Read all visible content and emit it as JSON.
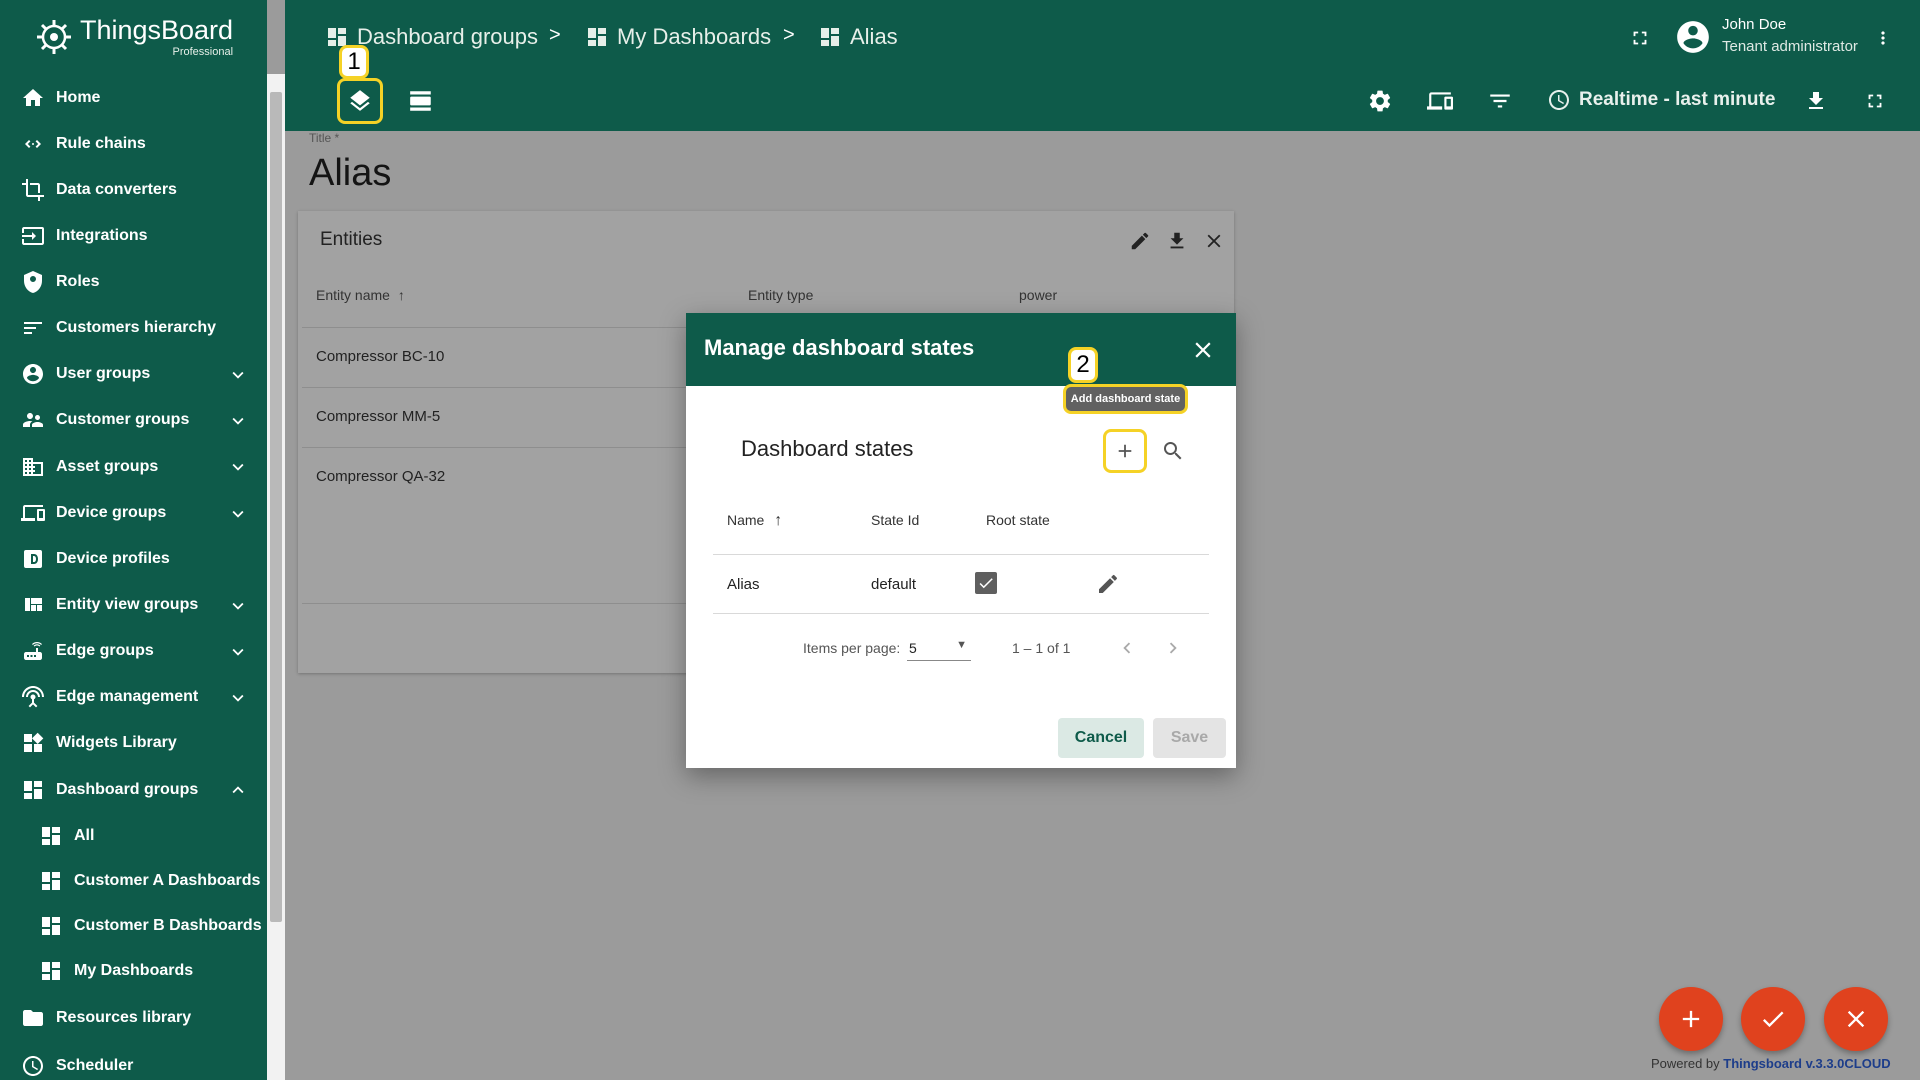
{
  "app": {
    "brand": "ThingsBoard",
    "edition": "Professional",
    "accent": "#0e5b4a",
    "fab_color": "#e0421e",
    "highlight_color": "#f5d226"
  },
  "sidebar": {
    "items": [
      {
        "label": "Home",
        "icon": "home-icon"
      },
      {
        "label": "Rule chains",
        "icon": "rule-chains-icon"
      },
      {
        "label": "Data converters",
        "icon": "data-converters-icon"
      },
      {
        "label": "Integrations",
        "icon": "integrations-icon"
      },
      {
        "label": "Roles",
        "icon": "shield-icon"
      },
      {
        "label": "Customers hierarchy",
        "icon": "hierarchy-icon"
      },
      {
        "label": "User groups",
        "icon": "account-circle-icon"
      },
      {
        "label": "Customer groups",
        "icon": "supervisor-icon"
      },
      {
        "label": "Asset groups",
        "icon": "domain-icon"
      },
      {
        "label": "Device groups",
        "icon": "devices-icon"
      },
      {
        "label": "Device profiles",
        "icon": "device-profile-icon"
      },
      {
        "label": "Entity view groups",
        "icon": "view-quilt-icon"
      },
      {
        "label": "Edge groups",
        "icon": "router-icon"
      },
      {
        "label": "Edge management",
        "icon": "settings-input-antenna-icon"
      },
      {
        "label": "Widgets Library",
        "icon": "widgets-icon"
      },
      {
        "label": "Dashboard groups",
        "icon": "dashboard-icon"
      },
      {
        "label": "All",
        "icon": "dashboard-icon"
      },
      {
        "label": "Customer A Dashboards",
        "icon": "dashboard-icon"
      },
      {
        "label": "Customer B Dashboards",
        "icon": "dashboard-icon"
      },
      {
        "label": "My Dashboards",
        "icon": "dashboard-icon"
      },
      {
        "label": "Resources library",
        "icon": "folder-icon"
      },
      {
        "label": "Scheduler",
        "icon": "schedule-icon"
      }
    ]
  },
  "header": {
    "breadcrumbs": [
      "Dashboard groups",
      "My Dashboards",
      "Alias"
    ],
    "separator": ">",
    "user_name": "John Doe",
    "user_role": "Tenant administrator",
    "timewindow": "Realtime - last minute"
  },
  "dashboard": {
    "title_label": "Title *",
    "title": "Alias"
  },
  "entities_widget": {
    "title": "Entities",
    "columns": [
      "Entity name",
      "Entity type",
      "power"
    ],
    "rows": [
      "Compressor BC-10",
      "Compressor MM-5",
      "Compressor QA-32"
    ]
  },
  "dialog": {
    "title": "Manage dashboard states",
    "section_title": "Dashboard states",
    "tooltip": "Add dashboard state",
    "columns": [
      "Name",
      "State Id",
      "Root state"
    ],
    "row": {
      "name": "Alias",
      "state_id": "default",
      "root_state": true
    },
    "items_per_page_label": "Items per page:",
    "items_per_page": "5",
    "range": "1 – 1 of 1",
    "cancel": "Cancel",
    "save": "Save"
  },
  "callouts": {
    "first": "1",
    "second": "2"
  },
  "footer": {
    "powered_prefix": "Powered by",
    "powered_link": "Thingsboard v.3.3.0CLOUD"
  }
}
